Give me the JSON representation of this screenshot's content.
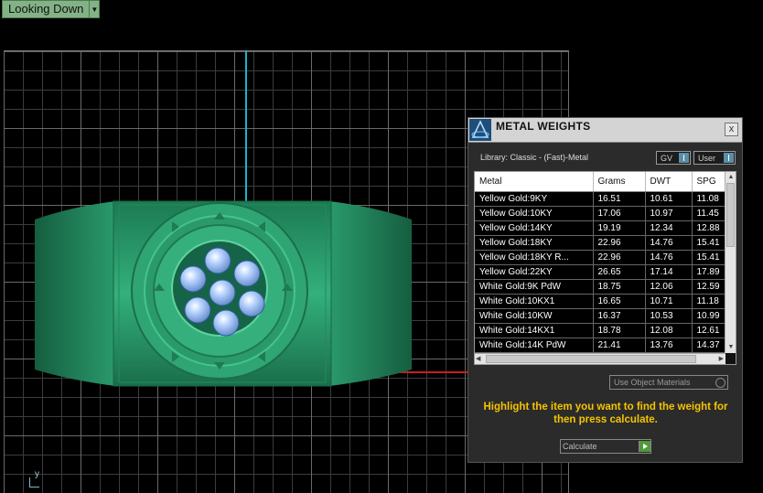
{
  "viewport": {
    "view_label": "Looking Down",
    "axis_label": "y"
  },
  "panel": {
    "title": "METAL WEIGHTS",
    "close_glyph": "x",
    "library_label": "Library: Classic - (Fast)-Metal",
    "toggle_gv": "GV",
    "toggle_user": "User",
    "columns": [
      "Metal",
      "Grams",
      "DWT",
      "SPG"
    ],
    "rows": [
      [
        "Yellow Gold:9KY",
        "16.51",
        "10.61",
        "11.08"
      ],
      [
        "Yellow Gold:10KY",
        "17.06",
        "10.97",
        "11.45"
      ],
      [
        "Yellow Gold:14KY",
        "19.19",
        "12.34",
        "12.88"
      ],
      [
        "Yellow Gold:18KY",
        "22.96",
        "14.76",
        "15.41"
      ],
      [
        "Yellow Gold:18KY R...",
        "22.96",
        "14.76",
        "15.41"
      ],
      [
        "Yellow Gold:22KY",
        "26.65",
        "17.14",
        "17.89"
      ],
      [
        "White Gold:9K PdW",
        "18.75",
        "12.06",
        "12.59"
      ],
      [
        "White Gold:10KX1",
        "16.65",
        "10.71",
        "11.18"
      ],
      [
        "White Gold:10KW",
        "16.37",
        "10.53",
        "10.99"
      ],
      [
        "White Gold:14KX1",
        "18.78",
        "12.08",
        "12.61"
      ],
      [
        "White Gold:14K PdW",
        "21.41",
        "13.76",
        "14.37"
      ]
    ],
    "material_button": "Use Object Materials",
    "hint_text": "Highlight the item you want to find the weight for then press calculate.",
    "calculate_label": "Calculate"
  },
  "colors": {
    "ring": "#2e9e6e",
    "hint": "#f5c400",
    "view_label_bg": "#83b286",
    "axis_y": "#1fb3c8",
    "axis_x": "#c81e1e"
  }
}
